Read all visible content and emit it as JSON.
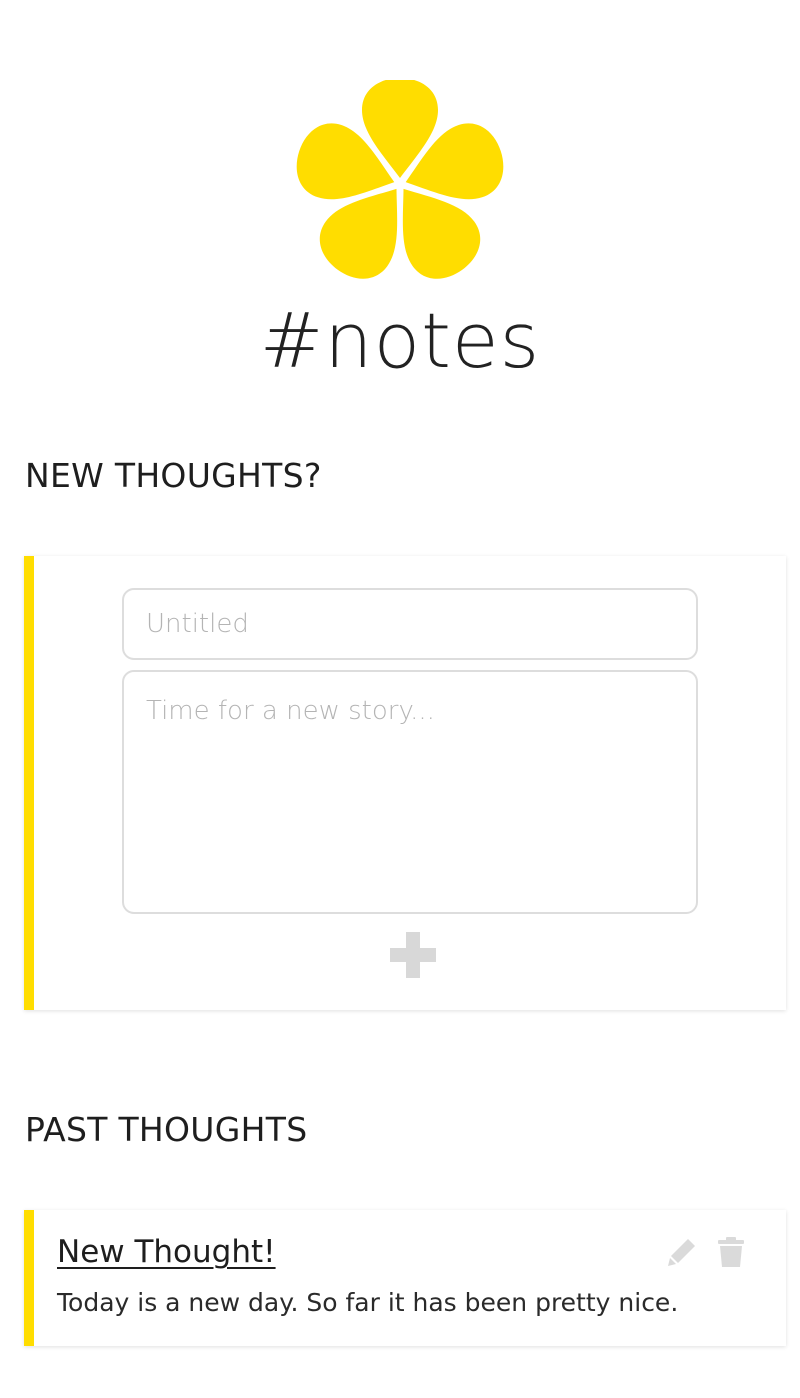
{
  "app": {
    "title": "#notes",
    "logo_icon": "flower-icon",
    "accent_color": "#ffdd00"
  },
  "new_section": {
    "heading": "NEW THOUGHTS?",
    "title_placeholder": "Untitled",
    "title_value": "",
    "body_placeholder": "Time for a new story...",
    "body_value": "",
    "add_icon": "plus-icon"
  },
  "past_section": {
    "heading": "PAST THOUGHTS",
    "notes": [
      {
        "title": "New Thought!",
        "body": "Today is a new day. So far it has been pretty nice.",
        "edit_icon": "pencil-icon",
        "delete_icon": "trash-icon"
      }
    ]
  }
}
